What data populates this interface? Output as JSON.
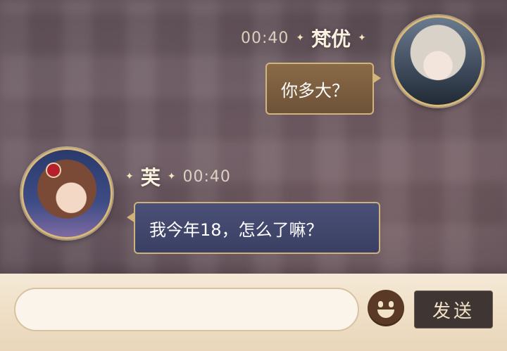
{
  "messages": [
    {
      "sender": "梵优",
      "time": "00:40",
      "text": "你多大？",
      "side": "right"
    },
    {
      "sender": "芙",
      "time": "00:40",
      "text": "我今年18，怎么了嘛？",
      "side": "left"
    }
  ],
  "input": {
    "value": "",
    "placeholder": ""
  },
  "buttons": {
    "emoji_icon": "smiley-face",
    "send_label": "发送"
  },
  "colors": {
    "bubble_right": "#7c5f40",
    "bubble_left": "#434870",
    "bubble_border": "#d2b57b",
    "input_bar": "#efdfc6",
    "send_button": "#3f3633"
  }
}
